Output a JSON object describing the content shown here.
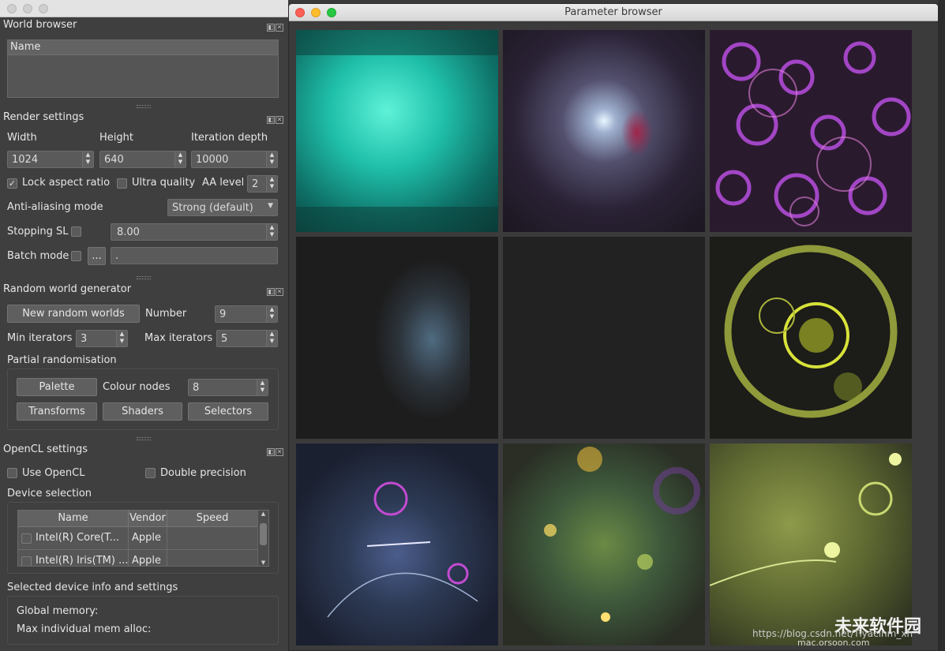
{
  "world_browser": {
    "title": "World browser",
    "column": "Name"
  },
  "render_settings": {
    "title": "Render settings",
    "width_label": "Width",
    "height_label": "Height",
    "depth_label": "Iteration depth",
    "width": "1024",
    "height": "640",
    "depth": "10000",
    "lock_aspect": "Lock aspect ratio",
    "ultra_quality": "Ultra quality",
    "aa_level_label": "AA level",
    "aa_level": "2",
    "aa_mode_label": "Anti-aliasing mode",
    "aa_mode": "Strong (default)",
    "stopping_sl_label": "Stopping SL",
    "stopping_sl": "8.00",
    "batch_mode_label": "Batch mode",
    "batch_button": "...",
    "batch_path": "."
  },
  "random_world": {
    "title": "Random world generator",
    "new_button": "New random worlds",
    "number_label": "Number",
    "number": "9",
    "min_iter_label": "Min iterators",
    "min_iter": "3",
    "max_iter_label": "Max iterators",
    "max_iter": "5",
    "partial_title": "Partial randomisation",
    "palette_button": "Palette",
    "colour_nodes_label": "Colour nodes",
    "colour_nodes": "8",
    "transforms_button": "Transforms",
    "shaders_button": "Shaders",
    "selectors_button": "Selectors"
  },
  "opencl": {
    "title": "OpenCL settings",
    "use_opencl": "Use OpenCL",
    "double_precision": "Double precision",
    "device_selection": "Device selection",
    "columns": [
      "Name",
      "Vendor",
      "Speed"
    ],
    "rows": [
      {
        "name": "Intel(R) Core(T...",
        "vendor": "Apple",
        "speed": ""
      },
      {
        "name": "Intel(R) Iris(TM) ...",
        "vendor": "Apple",
        "speed": ""
      }
    ],
    "device_info_title": "Selected device info and settings",
    "global_memory": "Global memory:",
    "max_alloc": "Max individual mem alloc:"
  },
  "parameter_browser": {
    "title": "Parameter browser"
  },
  "thumbnails": [
    "cyan-fractal",
    "starburst",
    "purple-curls",
    "sparse-spray",
    "dark-noise",
    "yellow-ring",
    "blue-swirl",
    "green-bubbles",
    "yellow-green-spirals"
  ],
  "watermark": {
    "url": "https://blog.csdn.net/Tiyacinm_xh",
    "site": "mac.orsoon.com",
    "logo": "未来软件园"
  }
}
